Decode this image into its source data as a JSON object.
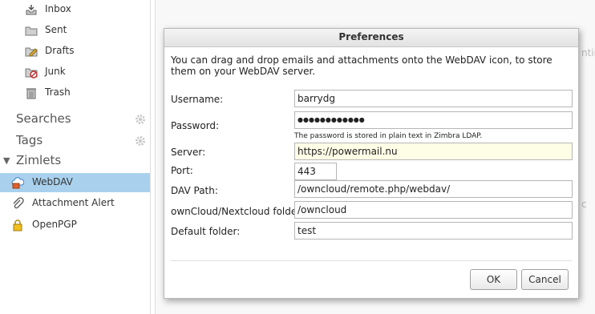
{
  "sidebar": {
    "folders": [
      {
        "label": "Inbox",
        "icon": "inbox-icon"
      },
      {
        "label": "Sent",
        "icon": "sent-folder-icon"
      },
      {
        "label": "Drafts",
        "icon": "drafts-icon"
      },
      {
        "label": "Junk",
        "icon": "junk-icon"
      },
      {
        "label": "Trash",
        "icon": "trash-icon"
      }
    ],
    "searches_label": "Searches",
    "tags_label": "Tags",
    "zimlets_label": "Zimlets",
    "zimlets": [
      {
        "label": "WebDAV",
        "icon": "webdav-icon",
        "selected": true
      },
      {
        "label": "Attachment Alert",
        "icon": "paperclip-icon",
        "selected": false
      },
      {
        "label": "OpenPGP",
        "icon": "lock-icon",
        "selected": false
      }
    ]
  },
  "background": {
    "fragment_1": "ntinu",
    "fragment_2": "c"
  },
  "dialog": {
    "title": "Preferences",
    "intro": "You can drag and drop emails and attachments onto the WebDAV icon, to store them on your WebDAV server.",
    "username_label": "Username:",
    "username_value": "barrydg",
    "password_label": "Password:",
    "password_value": "●●●●●●●●●●●●",
    "password_note": "The password is stored in plain text in Zimbra LDAP.",
    "server_label": "Server:",
    "server_value": "https://powermail.nu",
    "port_label": "Port:",
    "port_value": "443",
    "davpath_label": "DAV Path:",
    "davpath_value": "/owncloud/remote.php/webdav/",
    "owncloud_label": "ownCloud/Nextcloud folder:",
    "owncloud_value": "/owncloud",
    "default_label": "Default folder:",
    "default_value": "test",
    "ok_label": "OK",
    "cancel_label": "Cancel"
  },
  "colors": {
    "selected_row": "#a9d1ed",
    "highlight_field": "#fefde6"
  }
}
